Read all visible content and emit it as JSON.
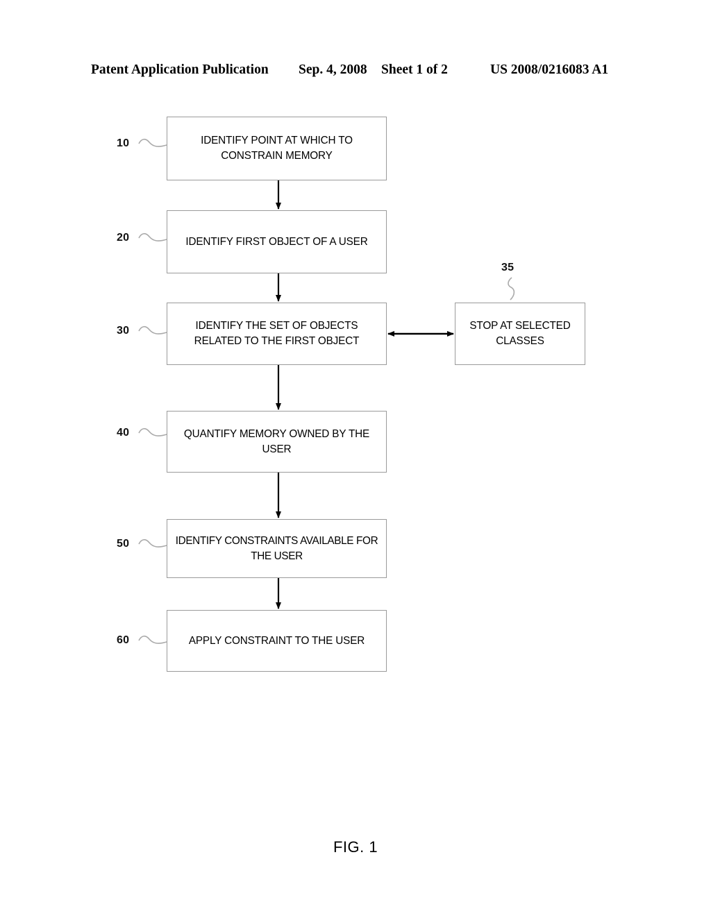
{
  "header": {
    "publication": "Patent Application Publication",
    "date": "Sep. 4, 2008",
    "sheet": "Sheet 1 of 2",
    "number": "US 2008/0216083 A1"
  },
  "figure": {
    "caption": "FIG. 1",
    "nodes": [
      {
        "ref": "10",
        "label": "IDENTIFY POINT AT WHICH TO\nCONSTRAIN MEMORY"
      },
      {
        "ref": "20",
        "label": "IDENTIFY FIRST OBJECT OF A USER"
      },
      {
        "ref": "30",
        "label": "IDENTIFY THE SET OF OBJECTS\nRELATED TO THE FIRST OBJECT"
      },
      {
        "ref": "35",
        "label": "STOP AT SELECTED\nCLASSES"
      },
      {
        "ref": "40",
        "label": "QUANTIFY MEMORY OWNED BY THE\nUSER"
      },
      {
        "ref": "50",
        "label": "IDENTIFY CONSTRAINTS AVAILABLE FOR\nTHE USER"
      },
      {
        "ref": "60",
        "label": "APPLY CONSTRAINT TO THE USER"
      }
    ]
  },
  "colors": {
    "ink": "#000000",
    "box_border": "#9a9a9a",
    "leader_line": "#a9a9a9",
    "page_background": "#ffffff"
  }
}
